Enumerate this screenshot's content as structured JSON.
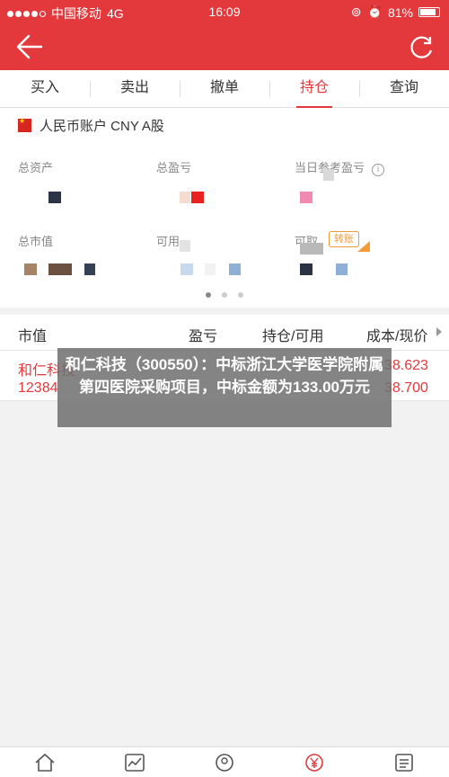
{
  "status_bar": {
    "carrier": "中国移动",
    "network": "4G",
    "time": "16:09",
    "battery": "81%"
  },
  "tabs": [
    {
      "label": "买入"
    },
    {
      "label": "卖出"
    },
    {
      "label": "撤单"
    },
    {
      "label": "持仓",
      "active": true
    },
    {
      "label": "查询"
    }
  ],
  "account": {
    "title": "人民币账户 CNY A股",
    "labels": {
      "total_assets": "总资产",
      "total_pnl": "总盈亏",
      "today_pnl": "当日参考盈亏",
      "market_value": "总市值",
      "available": "可用",
      "withdrawable": "可取"
    },
    "transfer_button": "转账"
  },
  "holdings": {
    "headers": [
      "市值",
      "盈亏",
      "持仓/可用",
      "成本/现价"
    ],
    "rows": [
      {
        "name": "和仁科技",
        "code": "12384",
        "cost": "38.623",
        "price": "38.700"
      }
    ]
  },
  "overlay": {
    "headline": "和仁科技（300550）：中标浙江大学医学院附属第四医院采购项目，中标金额为133.00万元"
  },
  "colors": {
    "brand": "#e4393c",
    "accent_orange": "#f29b38"
  },
  "icons": {
    "tabbar": [
      "home-icon",
      "chart-icon",
      "user-icon",
      "yuan-icon",
      "menu-icon"
    ]
  }
}
